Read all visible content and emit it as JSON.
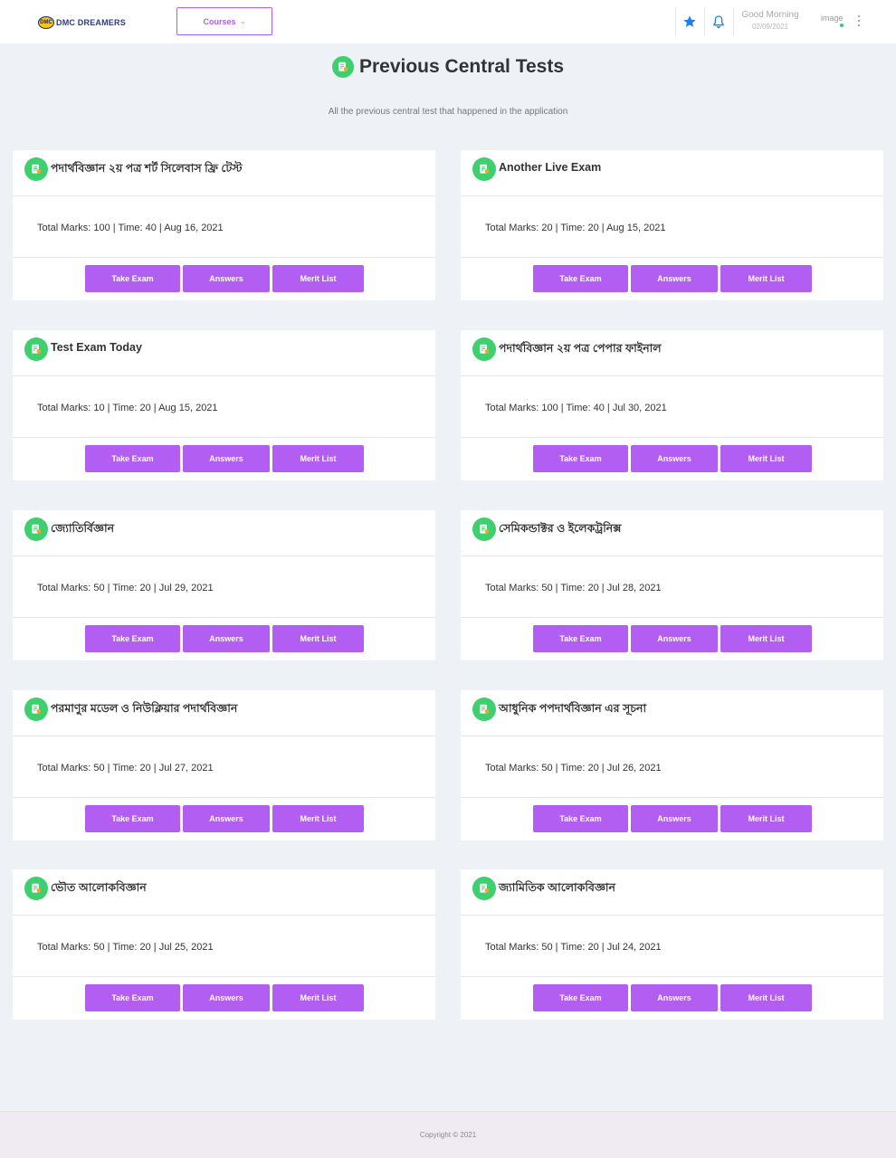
{
  "navbar": {
    "logo_text": "DMC DREAMERS",
    "logo_badge": "DMC",
    "courses_label": "Courses",
    "greeting": "Good Morning",
    "date": "02/09/2021",
    "avatar_alt": "image",
    "accent_color": "#b25ef3",
    "star_icon": "star-icon",
    "bell_icon": "bell-icon"
  },
  "header": {
    "title": "Previous Central Tests",
    "subtitle": "All the previous central test that happened in the application"
  },
  "buttons": {
    "take_exam": "Take Exam",
    "answers": "Answers",
    "merit_list": "Merit List"
  },
  "tests": [
    {
      "title": "পদার্থবিজ্ঞান ২য় পত্র শর্ট সিলেবাস ফ্রি টেস্ট",
      "meta": "Total Marks: 100 | Time: 40 | Aug 16, 2021"
    },
    {
      "title": "Another Live Exam",
      "meta": "Total Marks: 20 | Time: 20 | Aug 15, 2021"
    },
    {
      "title": "Test Exam Today",
      "meta": "Total Marks: 10 | Time: 20 | Aug 15, 2021"
    },
    {
      "title": "পদার্থবিজ্ঞান ২য় পত্র পেপার ফাইনাল",
      "meta": "Total Marks: 100 | Time: 40 | Jul 30, 2021"
    },
    {
      "title": "জ্যোতির্বিজ্ঞান",
      "meta": "Total Marks: 50 | Time: 20 | Jul 29, 2021"
    },
    {
      "title": "সেমিকন্ডাক্টর ও ইলেকট্রনিক্স",
      "meta": "Total Marks: 50 | Time: 20 | Jul 28, 2021"
    },
    {
      "title": "পরমাণুর মডেল ও নিউক্লিয়ার পদার্থবিজ্ঞান",
      "meta": "Total Marks: 50 | Time: 20 | Jul 27, 2021"
    },
    {
      "title": "আধুনিক পপদার্থবিজ্ঞান এর সূচনা",
      "meta": "Total Marks: 50 | Time: 20 | Jul 26, 2021"
    },
    {
      "title": "ভৌত আলোকবিজ্ঞান",
      "meta": "Total Marks: 50 | Time: 20 | Jul 25, 2021"
    },
    {
      "title": "জ্যামিতিক আলোকবিজ্ঞান",
      "meta": "Total Marks: 50 | Time: 20 | Jul 24, 2021"
    }
  ],
  "footer": {
    "copyright": "Copyright © 2021"
  }
}
